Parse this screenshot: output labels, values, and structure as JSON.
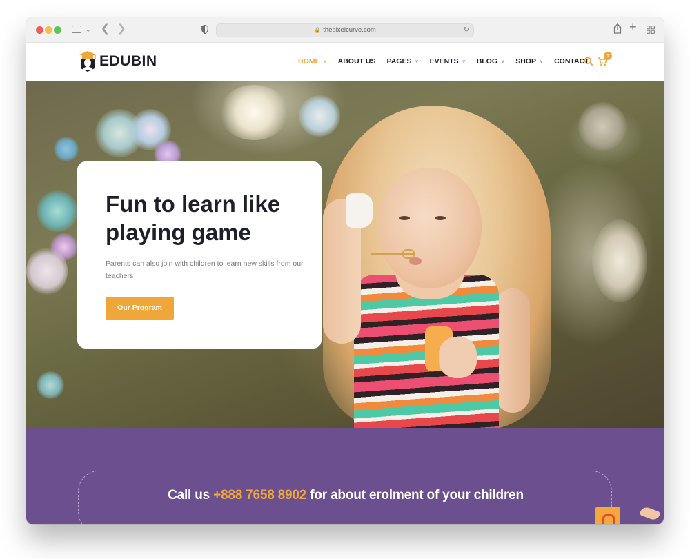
{
  "browser": {
    "url": "thepixelcurve.com",
    "icons": [
      "sidebar-icon",
      "chevron-down-icon",
      "back-icon",
      "forward-icon",
      "shield-icon",
      "lock-icon",
      "reload-icon",
      "share-icon",
      "new-tab-icon",
      "tab-overview-icon"
    ]
  },
  "site": {
    "logo_text": "EDUBIN",
    "nav": [
      {
        "label": "HOME",
        "has_dropdown": true,
        "active": true
      },
      {
        "label": "ABOUT US",
        "has_dropdown": false,
        "active": false
      },
      {
        "label": "PAGES",
        "has_dropdown": true,
        "active": false
      },
      {
        "label": "EVENTS",
        "has_dropdown": true,
        "active": false
      },
      {
        "label": "BLOG",
        "has_dropdown": true,
        "active": false
      },
      {
        "label": "SHOP",
        "has_dropdown": true,
        "active": false
      },
      {
        "label": "CONTACT",
        "has_dropdown": false,
        "active": false
      }
    ],
    "chevron_glyph": "∨",
    "cart_count": "0"
  },
  "hero": {
    "title": "Fun to learn like playing game",
    "subtitle": "Parents can also join with children to learn new skills from our teachers",
    "button_label": "Our Program",
    "image_description": "girl blowing soap bubbles in a striped dress"
  },
  "call": {
    "prefix": "Call us ",
    "phone": "+888 7658 8902",
    "suffix": " for about erolment of your children"
  },
  "colors": {
    "accent": "#f0a73a",
    "dark_text": "#1f1f2b",
    "purple": "#6b4f8f"
  }
}
